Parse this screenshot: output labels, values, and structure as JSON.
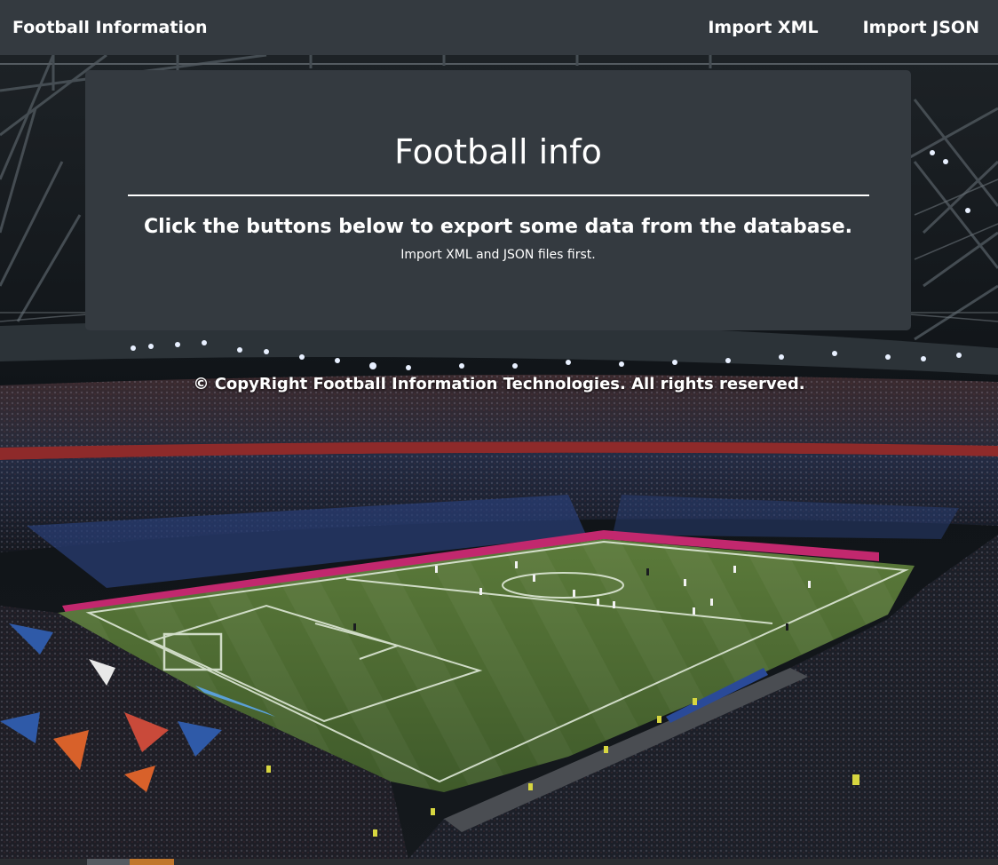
{
  "navbar": {
    "brand": "Football Information",
    "links": [
      {
        "label": "Import XML"
      },
      {
        "label": "Import JSON"
      }
    ]
  },
  "panel": {
    "title": "Football info",
    "lead": "Click the buttons below to export some data from the database.",
    "note": "Import XML and JSON files first."
  },
  "footer": {
    "copyright": "© CopyRight Football Information Technologies. All rights reserved."
  },
  "background": {
    "subject": "stadium-photo"
  },
  "colors": {
    "navbar": "#343a40",
    "panel": "#343a40",
    "pitch": "#4f6b35",
    "text": "#ffffff"
  }
}
